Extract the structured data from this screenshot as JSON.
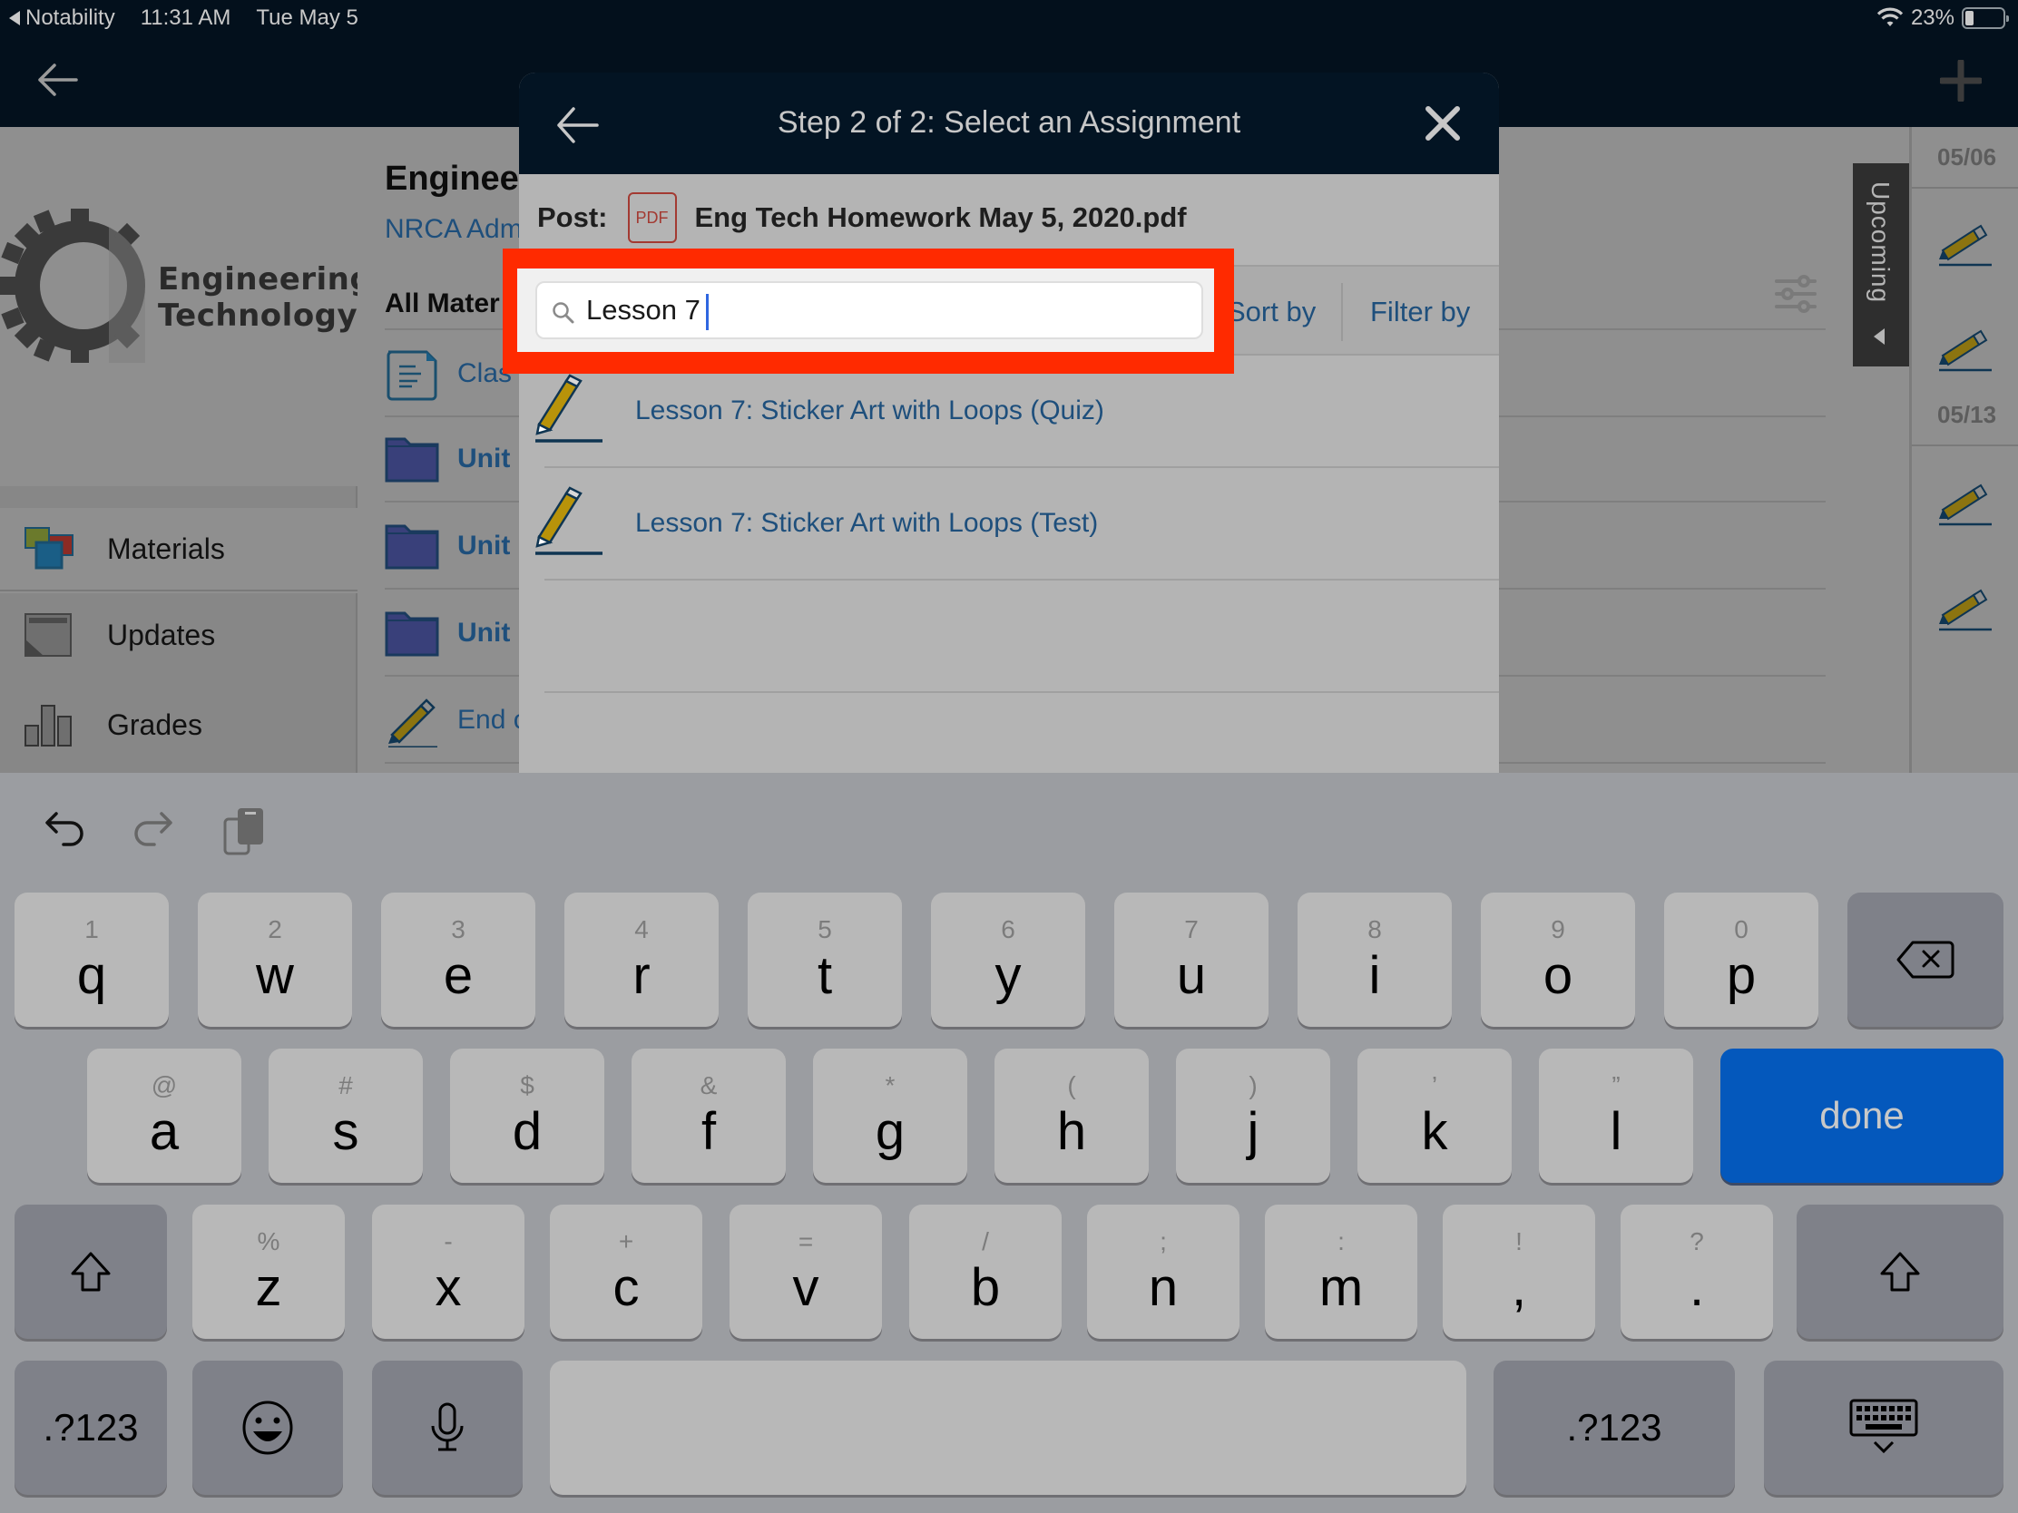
{
  "status_bar": {
    "back_app": "Notability",
    "time": "11:31 AM",
    "date": "Tue May 5",
    "battery_text": "23%",
    "battery_level": 0.23,
    "icons": [
      "back-triangle-icon",
      "wifi-icon",
      "battery-icon"
    ]
  },
  "app_bar": {
    "icons": [
      "back-arrow-icon",
      "plus-icon"
    ]
  },
  "sidebar": {
    "logo_line1": "Engineering",
    "logo_line2": "Technology",
    "items": [
      {
        "label": "Materials",
        "icon": "materials-icon"
      },
      {
        "label": "Updates",
        "icon": "updates-icon"
      },
      {
        "label": "Grades",
        "icon": "grades-icon"
      }
    ]
  },
  "content": {
    "course_title": "Enginee",
    "course_subtitle": "NRCA Adm",
    "section_title": "All Mater",
    "rows": [
      {
        "label": "Clas",
        "icon": "document-icon",
        "bold": false
      },
      {
        "label": "Unit",
        "icon": "folder-icon",
        "bold": true
      },
      {
        "label": "Unit",
        "icon": "folder-icon",
        "bold": true
      },
      {
        "label": "Unit",
        "icon": "folder-icon",
        "bold": true
      },
      {
        "label": "End o",
        "icon": "pencil-icon",
        "bold": false
      }
    ]
  },
  "upcoming": {
    "tab_label": "Upcoming",
    "dates": [
      "05/06",
      "05/13"
    ]
  },
  "modal": {
    "title": "Step 2 of 2: Select an Assignment",
    "post_label": "Post:",
    "file_badge": "PDF",
    "file_name": "Eng Tech Homework May 5, 2020.pdf",
    "search": {
      "value": "Lesson 7",
      "placeholder": ""
    },
    "sort_label": "Sort by",
    "filter_label": "Filter by",
    "results": [
      {
        "title": "Lesson 7: Sticker Art with Loops (Quiz)",
        "icon": "pencil-icon"
      },
      {
        "title": "Lesson 7: Sticker Art with Loops (Test)",
        "icon": "pencil-icon"
      }
    ],
    "highlight_color": "#ff2a00"
  },
  "keyboard": {
    "toolbar": [
      "undo-icon",
      "redo-icon",
      "paste-icon"
    ],
    "row1": [
      {
        "main": "q",
        "alt": "1"
      },
      {
        "main": "w",
        "alt": "2"
      },
      {
        "main": "e",
        "alt": "3"
      },
      {
        "main": "r",
        "alt": "4"
      },
      {
        "main": "t",
        "alt": "5"
      },
      {
        "main": "y",
        "alt": "6"
      },
      {
        "main": "u",
        "alt": "7"
      },
      {
        "main": "i",
        "alt": "8"
      },
      {
        "main": "o",
        "alt": "9"
      },
      {
        "main": "p",
        "alt": "0"
      }
    ],
    "row2": [
      {
        "main": "a",
        "alt": "@"
      },
      {
        "main": "s",
        "alt": "#"
      },
      {
        "main": "d",
        "alt": "$"
      },
      {
        "main": "f",
        "alt": "&"
      },
      {
        "main": "g",
        "alt": "*"
      },
      {
        "main": "h",
        "alt": "("
      },
      {
        "main": "j",
        "alt": ")"
      },
      {
        "main": "k",
        "alt": "’"
      },
      {
        "main": "l",
        "alt": "”"
      }
    ],
    "row3": [
      {
        "main": "z",
        "alt": "%"
      },
      {
        "main": "x",
        "alt": "-"
      },
      {
        "main": "c",
        "alt": "+"
      },
      {
        "main": "v",
        "alt": "="
      },
      {
        "main": "b",
        "alt": "/"
      },
      {
        "main": "n",
        "alt": ";"
      },
      {
        "main": "m",
        "alt": ":"
      },
      {
        "main": ",",
        "alt": "!"
      },
      {
        "main": ".",
        "alt": "?"
      }
    ],
    "done_label": "done",
    "numbers_label": ".?123",
    "accent_color": "#0458bc"
  }
}
